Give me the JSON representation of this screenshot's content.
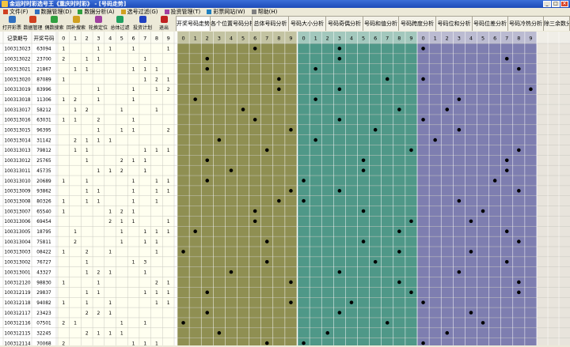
{
  "window": {
    "title": "金运时时彩选号王《重庆时时彩》 - [号码走势]",
    "min": "_",
    "max": "□",
    "close": "×"
  },
  "menu": [
    {
      "label": "文件(F)",
      "icon": "#d04020"
    },
    {
      "label": "数据管理(D)",
      "icon": "#3070c0"
    },
    {
      "label": "数据分析(A)",
      "icon": "#30a040"
    },
    {
      "label": "选号过滤(G)",
      "icon": "#d0a020"
    },
    {
      "label": "投资管理(T)",
      "icon": "#a040a0"
    },
    {
      "label": "彩票网站(W)",
      "icon": "#2080c0"
    },
    {
      "label": "帮助(H)",
      "icon": "#808080"
    }
  ],
  "toolbar": [
    {
      "label": "打开彩票",
      "icon": "#3070c0"
    },
    {
      "label": "数据管理",
      "icon": "#d04020"
    },
    {
      "label": "偶数搜索",
      "icon": "#30a040"
    },
    {
      "label": "回补搜索",
      "icon": "#d0a020"
    },
    {
      "label": "轮换定位",
      "icon": "#a040a0"
    },
    {
      "label": "总体过滤",
      "icon": "#20a060"
    },
    {
      "label": "投资计划",
      "icon": "#2040c0"
    },
    {
      "label": "退出",
      "icon": "#c02020"
    }
  ],
  "tabs": [
    "开奖号码走势",
    "各个位置号码分析",
    "总体号码分析",
    "号码大小分析",
    "号码奇偶分析",
    "号码和值分析",
    "号码跨度分析",
    "号码位和分析",
    "号码位差分析",
    "号码冷热分析",
    "除三余数分析"
  ],
  "active_tab": 0,
  "table": {
    "headers": {
      "issue": "记录期号",
      "code": "开奖号码",
      "digits": [
        "0",
        "1",
        "2",
        "3",
        "4",
        "5",
        "6",
        "7",
        "8",
        "9"
      ]
    },
    "rows": [
      {
        "issue": "100313023",
        "code": "63094"
      },
      {
        "issue": "100313022",
        "code": "23700"
      },
      {
        "issue": "100313021",
        "code": "21867"
      },
      {
        "issue": "100313020",
        "code": "87089"
      },
      {
        "issue": "100313019",
        "code": "83996"
      },
      {
        "issue": "100313018",
        "code": "11306"
      },
      {
        "issue": "100313017",
        "code": "58212"
      },
      {
        "issue": "100313016",
        "code": "63031"
      },
      {
        "issue": "100313015",
        "code": "96395"
      },
      {
        "issue": "100313014",
        "code": "31142"
      },
      {
        "issue": "100313013",
        "code": "79812"
      },
      {
        "issue": "100313012",
        "code": "25765"
      },
      {
        "issue": "100313011",
        "code": "45735"
      },
      {
        "issue": "100313010",
        "code": "20689"
      },
      {
        "issue": "100313009",
        "code": "93862"
      },
      {
        "issue": "100313008",
        "code": "80326"
      },
      {
        "issue": "100313007",
        "code": "65540"
      },
      {
        "issue": "100313006",
        "code": "69454"
      },
      {
        "issue": "100313005",
        "code": "18795"
      },
      {
        "issue": "100313004",
        "code": "75811"
      },
      {
        "issue": "100313003",
        "code": "08422"
      },
      {
        "issue": "100313002",
        "code": "76727"
      },
      {
        "issue": "100313001",
        "code": "43327"
      },
      {
        "issue": "100312120",
        "code": "98830"
      },
      {
        "issue": "100312119",
        "code": "29837"
      },
      {
        "issue": "100312118",
        "code": "94082"
      },
      {
        "issue": "100312117",
        "code": "23423"
      },
      {
        "issue": "100312116",
        "code": "07501"
      },
      {
        "issue": "100312115",
        "code": "32245"
      },
      {
        "issue": "100312114",
        "code": "70068"
      }
    ]
  },
  "colors": {
    "pos1": "#8f8f52",
    "pos2": "#4f9888",
    "pos3": "#7e7eb0",
    "tail": "#e8e4dc",
    "digitArea": "#fffff0",
    "tab_bg": "#f4f2e8"
  }
}
